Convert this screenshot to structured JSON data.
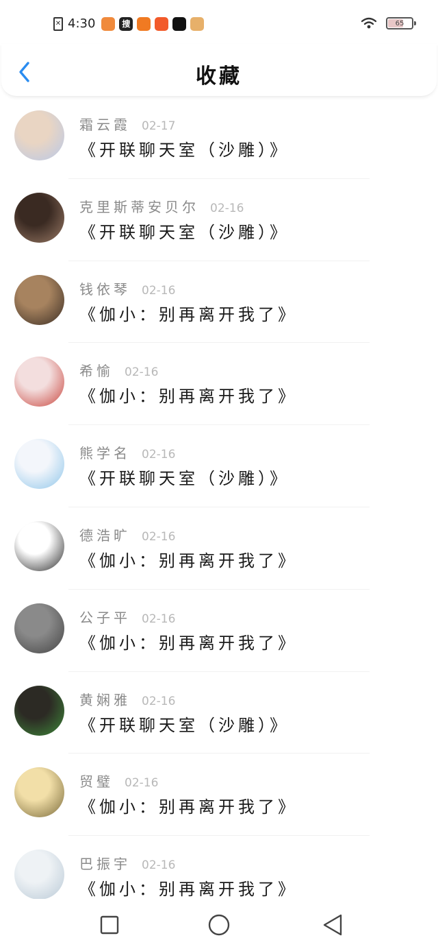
{
  "status_bar": {
    "time": "4:30",
    "sim_glyph": "✕",
    "app_icons": [
      {
        "name": "app-icon-1",
        "glyph": "",
        "color": "#f08a3c"
      },
      {
        "name": "sogou-search-icon",
        "glyph": "搜",
        "color": "#222222"
      },
      {
        "name": "app-icon-3",
        "glyph": "",
        "color": "#f07a22"
      },
      {
        "name": "app-icon-4",
        "glyph": "",
        "color": "#f25a2a"
      },
      {
        "name": "app-icon-5",
        "glyph": "",
        "color": "#111111"
      },
      {
        "name": "app-icon-6",
        "glyph": "",
        "color": "#e7b06a"
      }
    ],
    "battery_level": "65"
  },
  "header": {
    "back_icon": "chevron-left-icon",
    "title": "收藏"
  },
  "items": [
    {
      "name": "霜云霞",
      "date": "02-17",
      "message": "《开联聊天室（沙雕）》",
      "avatar_colors": [
        "#e9d5c3",
        "#b8c8e8"
      ]
    },
    {
      "name": "克里斯蒂安贝尔",
      "date": "02-16",
      "message": "《开联聊天室（沙雕）》",
      "avatar_colors": [
        "#3a2a22",
        "#9a7a66"
      ]
    },
    {
      "name": "钱依琴",
      "date": "02-16",
      "message": "《伽小：别再离开我了》",
      "avatar_colors": [
        "#a7835f",
        "#3a2d24"
      ]
    },
    {
      "name": "希愉",
      "date": "02-16",
      "message": "《伽小：别再离开我了》",
      "avatar_colors": [
        "#f3dede",
        "#c9463e"
      ]
    },
    {
      "name": "熊学名",
      "date": "02-16",
      "message": "《开联聊天室（沙雕）》",
      "avatar_colors": [
        "#f3f6fb",
        "#8fc6ea"
      ]
    },
    {
      "name": "德浩旷",
      "date": "02-16",
      "message": "《伽小：别再离开我了》",
      "avatar_colors": [
        "#ffffff",
        "#2a2a2a"
      ]
    },
    {
      "name": "公子平",
      "date": "02-16",
      "message": "《伽小：别再离开我了》",
      "avatar_colors": [
        "#8a8a8a",
        "#444444"
      ]
    },
    {
      "name": "黄娴雅",
      "date": "02-16",
      "message": "《开联聊天室（沙雕）》",
      "avatar_colors": [
        "#2c2a24",
        "#3f8a3a"
      ]
    },
    {
      "name": "贸璧",
      "date": "02-16",
      "message": "《伽小：别再离开我了》",
      "avatar_colors": [
        "#f2dfa8",
        "#7a6a3a"
      ]
    },
    {
      "name": "巴振宇",
      "date": "02-16",
      "message": "《伽小：别再离开我了》",
      "avatar_colors": [
        "#eef2f5",
        "#b9c9d6"
      ]
    }
  ],
  "nav": {
    "recents_icon": "square-icon",
    "home_icon": "circle-icon",
    "back_icon": "triangle-back-icon"
  },
  "colors": {
    "accent": "#2a8cf0",
    "name_text": "#8a8a8a",
    "date_text": "#b8b8b8",
    "message_text": "#1a1a1a"
  }
}
